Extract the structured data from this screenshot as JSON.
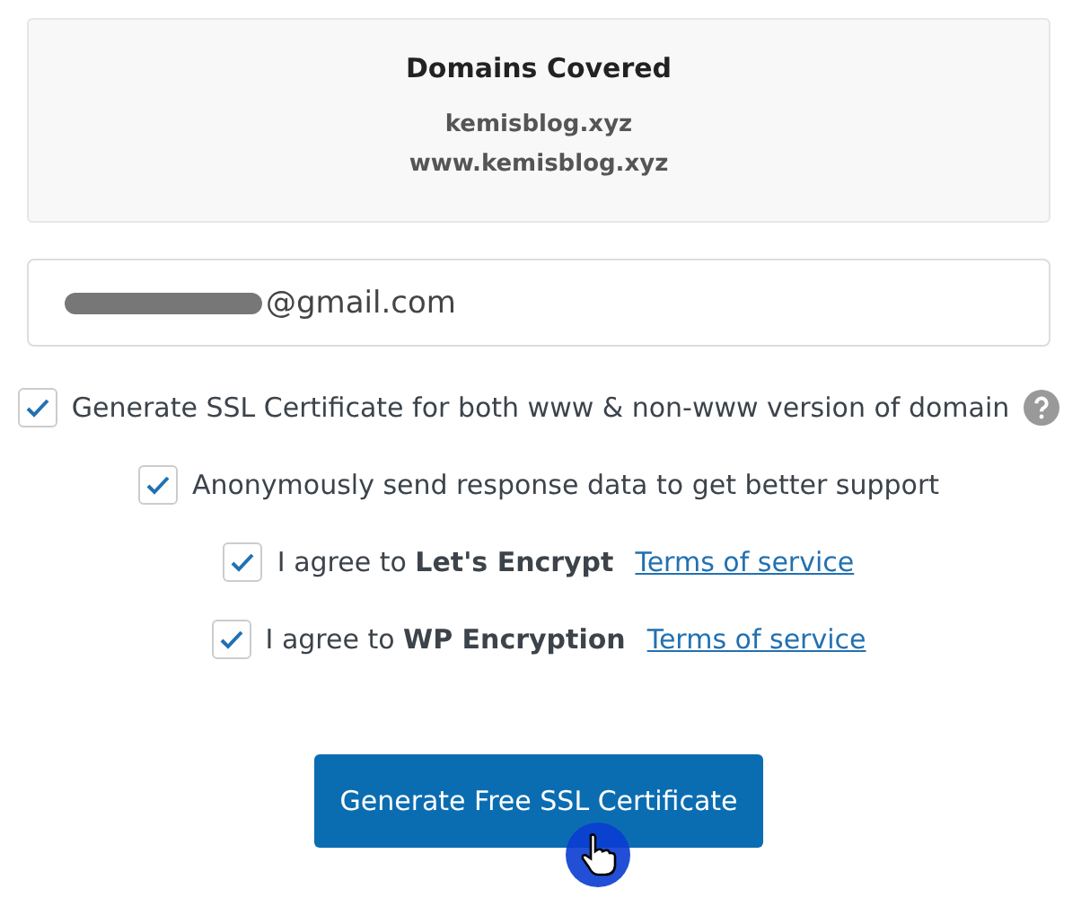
{
  "domains_card": {
    "title": "Domains Covered",
    "domains": [
      "kemisblog.xyz",
      "www.kemisblog.xyz"
    ]
  },
  "email_field": {
    "value": "@gmail.com",
    "redacted": true
  },
  "options": [
    {
      "label": "Generate SSL Certificate for both www & non-www version of domain",
      "checked": true,
      "help": true
    },
    {
      "label": "Anonymously send response data to get better support",
      "checked": true
    },
    {
      "label": "I agree to **Let's Encrypt**",
      "checked": true,
      "link": "Terms of service"
    },
    {
      "label": "I agree to **WP Encryption**",
      "checked": true,
      "link": "Terms of service"
    }
  ],
  "submit_button": {
    "label": "Generate Free SSL Certificate"
  }
}
